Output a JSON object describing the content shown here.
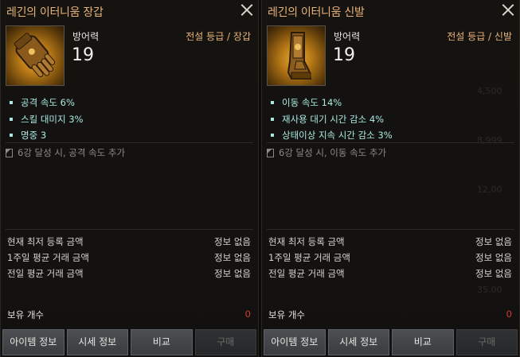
{
  "panels": [
    {
      "title": "레긴의 이터니움 장갑",
      "stat_label": "방어력",
      "stat_value": "19",
      "grade": "전설 등급 / 장갑",
      "icon": "gauntlet-icon",
      "attributes": [
        "공격 속도 6%",
        "스킬 대미지 3%",
        "명중 3"
      ],
      "enhance_note": "6강 달성 시, 공격 속도 추가",
      "market": [
        {
          "label": "현재 최저 등록 금액",
          "value": "정보 없음"
        },
        {
          "label": "1주일 평균 거래 금액",
          "value": "정보 없음"
        },
        {
          "label": "전일 평균 거래 금액",
          "value": "정보 없음"
        }
      ],
      "holding_label": "보유 개수",
      "holding_count": "0",
      "buttons": [
        "아이템 정보",
        "시세 정보",
        "비교",
        "구매"
      ]
    },
    {
      "title": "레긴의 이터니움 신발",
      "stat_label": "방어력",
      "stat_value": "19",
      "grade": "전설 등급 / 신발",
      "icon": "boot-icon",
      "attributes": [
        "이동 속도 14%",
        "재사용 대기 시간 감소 4%",
        "상태이상 지속 시간 감소 3%"
      ],
      "enhance_note": "6강 달성 시, 이동 속도 추가",
      "market": [
        {
          "label": "현재 최저 등록 금액",
          "value": "정보 없음"
        },
        {
          "label": "1주일 평균 거래 금액",
          "value": "정보 없음"
        },
        {
          "label": "전일 평균 거래 금액",
          "value": "정보 없음"
        }
      ],
      "holding_label": "보유 개수",
      "holding_count": "0",
      "buttons": [
        "아이템 정보",
        "시세 정보",
        "비교",
        "구매"
      ]
    }
  ],
  "background_values": [
    "4,500",
    "8,999",
    "12,00",
    "35,00"
  ],
  "colors": {
    "title": "#e9b27a",
    "attribute": "#a9e8e1",
    "count": "#d03a2e"
  }
}
